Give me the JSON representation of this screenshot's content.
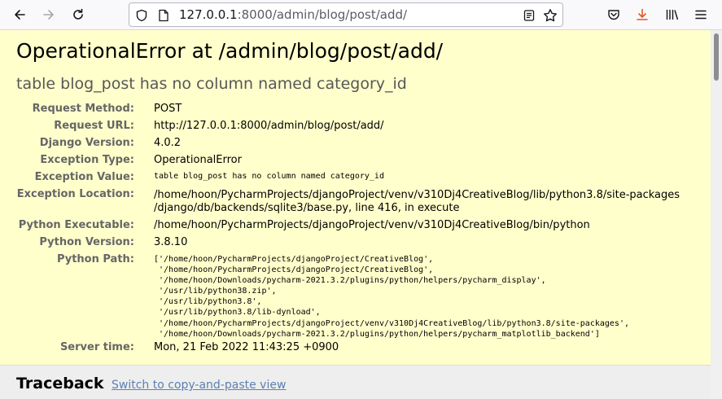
{
  "browser": {
    "url_host": "127.0.0.1",
    "url_rest": ":8000/admin/blog/post/add/",
    "icons": [
      "back-arrow-icon",
      "forward-arrow-icon",
      "reload-icon",
      "shield-icon",
      "page-icon",
      "reader-view-icon",
      "bookmark-star-icon",
      "pocket-icon",
      "download-icon",
      "library-icon",
      "menu-icon"
    ]
  },
  "error": {
    "title": "OperationalError at /admin/blog/post/add/",
    "message": "table blog_post has no column named category_id"
  },
  "details": [
    {
      "label": "Request Method:",
      "value": "POST"
    },
    {
      "label": "Request URL:",
      "value": "http://127.0.0.1:8000/admin/blog/post/add/"
    },
    {
      "label": "Django Version:",
      "value": "4.0.2"
    },
    {
      "label": "Exception Type:",
      "value": "OperationalError"
    },
    {
      "label": "Exception Value:",
      "value": "table blog_post has no column named category_id"
    },
    {
      "label": "Exception Location:",
      "value_line1": "/home/hoon/PycharmProjects/djangoProject/venv/v310Dj4CreativeBlog/lib/python3.8/site-packages",
      "value_line2": "/django/db/backends/sqlite3/base.py, line 416, in execute"
    },
    {
      "label": "Python Executable:",
      "value": "/home/hoon/PycharmProjects/djangoProject/venv/v310Dj4CreativeBlog/bin/python"
    },
    {
      "label": "Python Version:",
      "value": "3.8.10"
    },
    {
      "label": "Python Path:",
      "value": "['/home/hoon/PycharmProjects/djangoProject/CreativeBlog',\n '/home/hoon/PycharmProjects/djangoProject/CreativeBlog',\n '/home/hoon/Downloads/pycharm-2021.3.2/plugins/python/helpers/pycharm_display',\n '/usr/lib/python38.zip',\n '/usr/lib/python3.8',\n '/usr/lib/python3.8/lib-dynload',\n '/home/hoon/PycharmProjects/djangoProject/venv/v310Dj4CreativeBlog/lib/python3.8/site-packages',\n '/home/hoon/Downloads/pycharm-2021.3.2/plugins/python/helpers/pycharm_matplotlib_backend']"
    },
    {
      "label": "Server time:",
      "value": "Mon, 21 Feb 2022 11:43:25 +0900"
    }
  ],
  "traceback": {
    "title": "Traceback",
    "link": "Switch to copy-and-paste view"
  }
}
